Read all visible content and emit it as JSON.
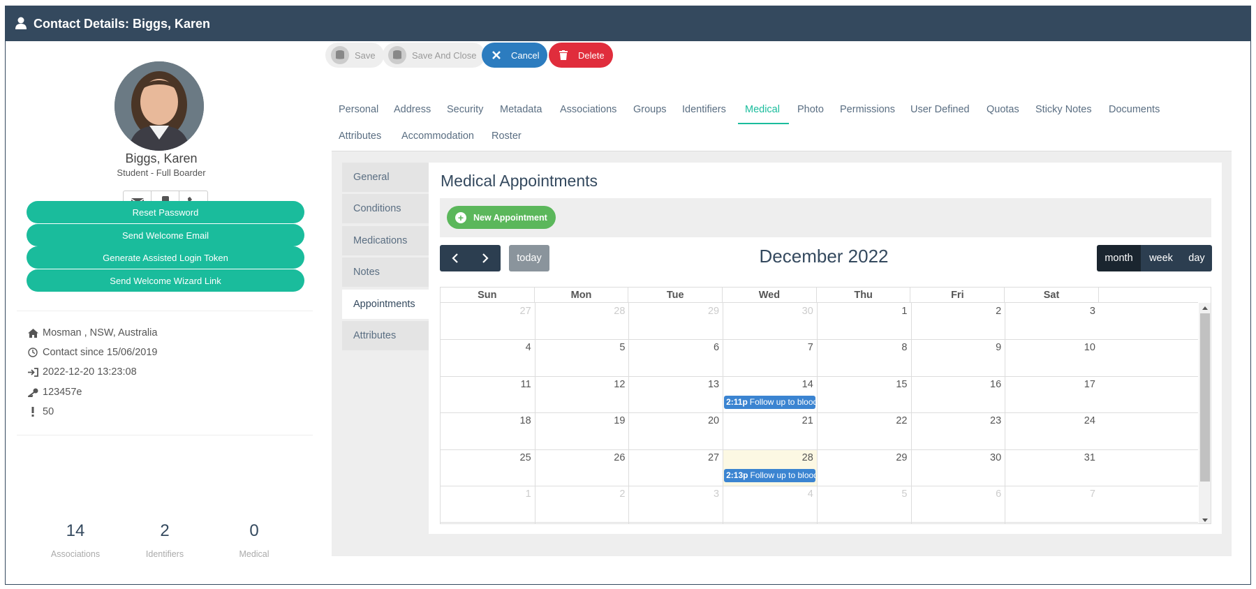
{
  "window": {
    "title": "Contact Details: Biggs, Karen"
  },
  "profile": {
    "name": "Biggs, Karen",
    "role": "Student - Full Boarder",
    "actions": [
      "Reset Password",
      "Send Welcome Email",
      "Generate Assisted Login Token",
      "Send Welcome Wizard Link"
    ],
    "info": {
      "location": "Mosman , NSW, Australia",
      "contact_since": "Contact since 15/06/2019",
      "last_login": "2022-12-20 13:23:08",
      "key": "123457e",
      "alert": "50"
    },
    "stats": [
      {
        "value": "14",
        "label": "Associations"
      },
      {
        "value": "2",
        "label": "Identifiers"
      },
      {
        "value": "0",
        "label": "Medical"
      }
    ]
  },
  "toolbar": {
    "save": "Save",
    "save_close": "Save And Close",
    "cancel": "Cancel",
    "delete": "Delete"
  },
  "tabs": [
    "Personal",
    "Address",
    "Security",
    "Metadata",
    "Associations",
    "Groups",
    "Identifiers",
    "Medical",
    "Photo",
    "Permissions",
    "User Defined",
    "Quotas",
    "Sticky Notes",
    "Documents",
    "Attributes",
    "Accommodation",
    "Roster"
  ],
  "active_tab": "Medical",
  "subnav": [
    "General",
    "Conditions",
    "Medications",
    "Notes",
    "Appointments",
    "Attributes"
  ],
  "active_subnav": "Appointments",
  "section_title": "Medical Appointments",
  "new_appointment": "New Appointment",
  "calendar": {
    "today_label": "today",
    "title": "December 2022",
    "views": [
      "month",
      "week",
      "day"
    ],
    "active_view": "month",
    "dow": [
      "Sun",
      "Mon",
      "Tue",
      "Wed",
      "Thu",
      "Fri",
      "Sat"
    ],
    "weeks": [
      [
        "27",
        "28",
        "29",
        "30",
        "1",
        "2",
        "3"
      ],
      [
        "4",
        "5",
        "6",
        "7",
        "8",
        "9",
        "10"
      ],
      [
        "11",
        "12",
        "13",
        "14",
        "15",
        "16",
        "17"
      ],
      [
        "18",
        "19",
        "20",
        "21",
        "22",
        "23",
        "24"
      ],
      [
        "25",
        "26",
        "27",
        "28",
        "29",
        "30",
        "31"
      ],
      [
        "1",
        "2",
        "3",
        "4",
        "5",
        "6",
        "7"
      ]
    ],
    "events": [
      {
        "time": "2:11p",
        "title": "Follow up to blood t",
        "date": "2022-12-14"
      },
      {
        "time": "2:13p",
        "title": "Follow up to blood t",
        "date": "2022-12-28"
      }
    ],
    "today": "2022-12-28"
  },
  "colors": {
    "header": "#34495e",
    "accent": "#1abc9c",
    "cancel": "#2c7cbf",
    "delete": "#e02d3c",
    "new": "#5bb75b",
    "event": "#3b84d1"
  }
}
